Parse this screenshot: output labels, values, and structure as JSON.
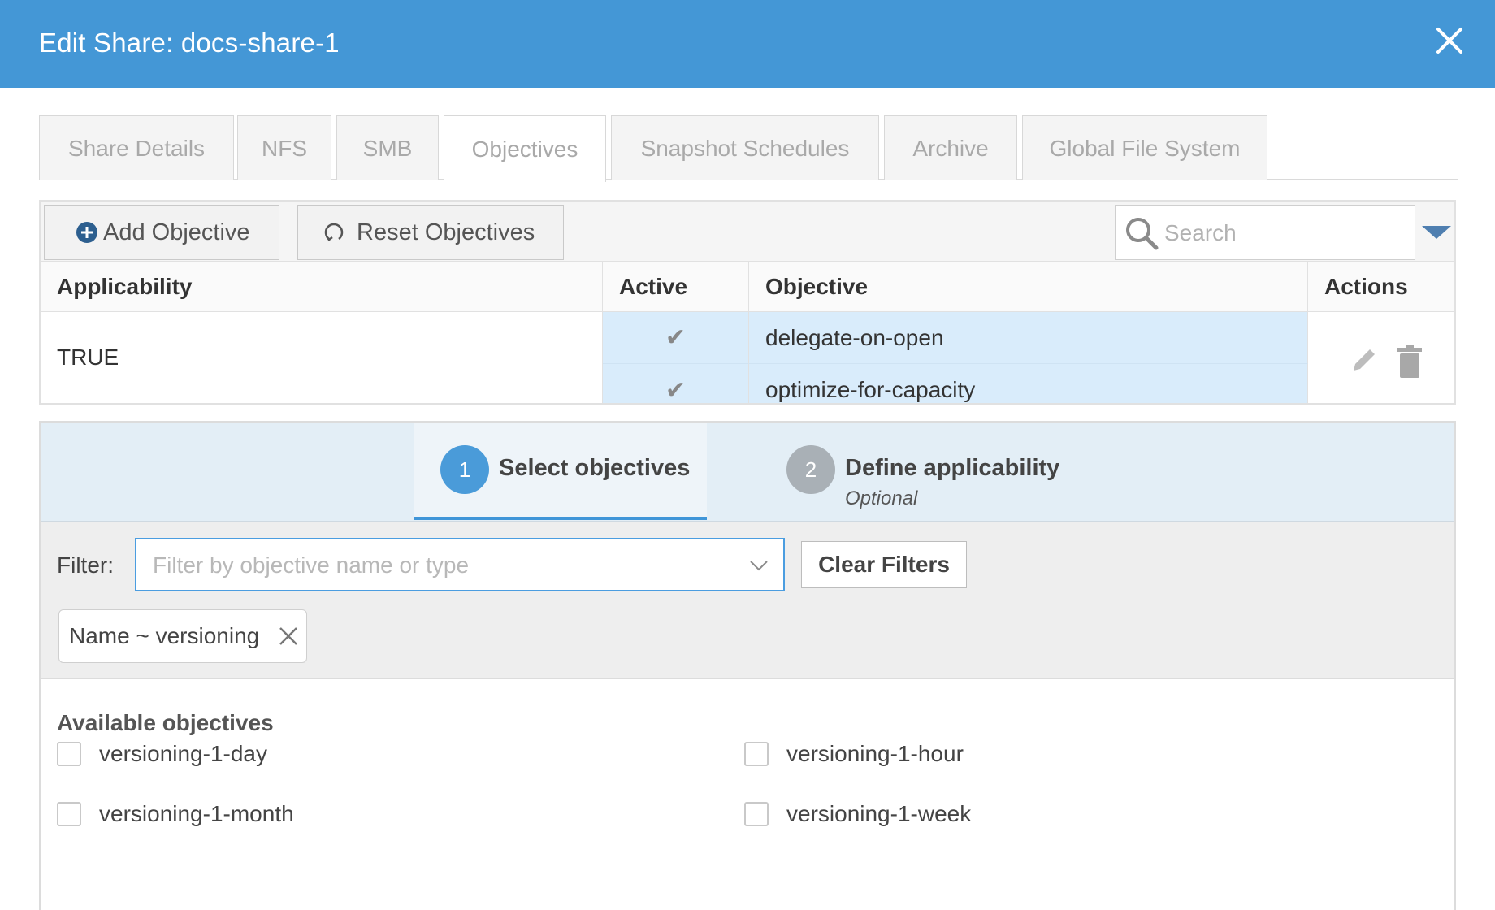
{
  "dialog": {
    "title": "Edit Share: docs-share-1",
    "close_icon": "close-icon"
  },
  "tabs": [
    {
      "label": "Share Details"
    },
    {
      "label": "NFS"
    },
    {
      "label": "SMB"
    },
    {
      "label": "Objectives",
      "active": true
    },
    {
      "label": "Snapshot Schedules"
    },
    {
      "label": "Archive"
    },
    {
      "label": "Global File System"
    }
  ],
  "toolbar": {
    "add_label": "Add Objective",
    "reset_label": "Reset Objectives",
    "search_placeholder": "Search"
  },
  "table": {
    "headers": {
      "applicability": "Applicability",
      "active": "Active",
      "objective": "Objective",
      "actions": "Actions"
    },
    "rows": [
      {
        "applicability": "TRUE",
        "objectives": [
          {
            "active": "✔",
            "name": "delegate-on-open"
          },
          {
            "active": "✔",
            "name": "optimize-for-capacity"
          }
        ]
      }
    ]
  },
  "wizard": {
    "steps": [
      {
        "number": "1",
        "label": "Select objectives",
        "active": true
      },
      {
        "number": "2",
        "label": "Define applicability",
        "sub": "Optional"
      }
    ],
    "filter": {
      "label": "Filter:",
      "placeholder": "Filter by objective name or type",
      "clear_label": "Clear Filters",
      "chip": "Name ~ versioning"
    },
    "available": {
      "title": "Available objectives",
      "options": [
        {
          "label": "versioning-1-day",
          "checked": false
        },
        {
          "label": "versioning-1-hour",
          "checked": false
        },
        {
          "label": "versioning-1-month",
          "checked": false
        },
        {
          "label": "versioning-1-week",
          "checked": false
        }
      ]
    }
  },
  "colors": {
    "header": "#4497d6",
    "accent": "#3f95d8",
    "row_highlight": "#d9ecfb"
  }
}
